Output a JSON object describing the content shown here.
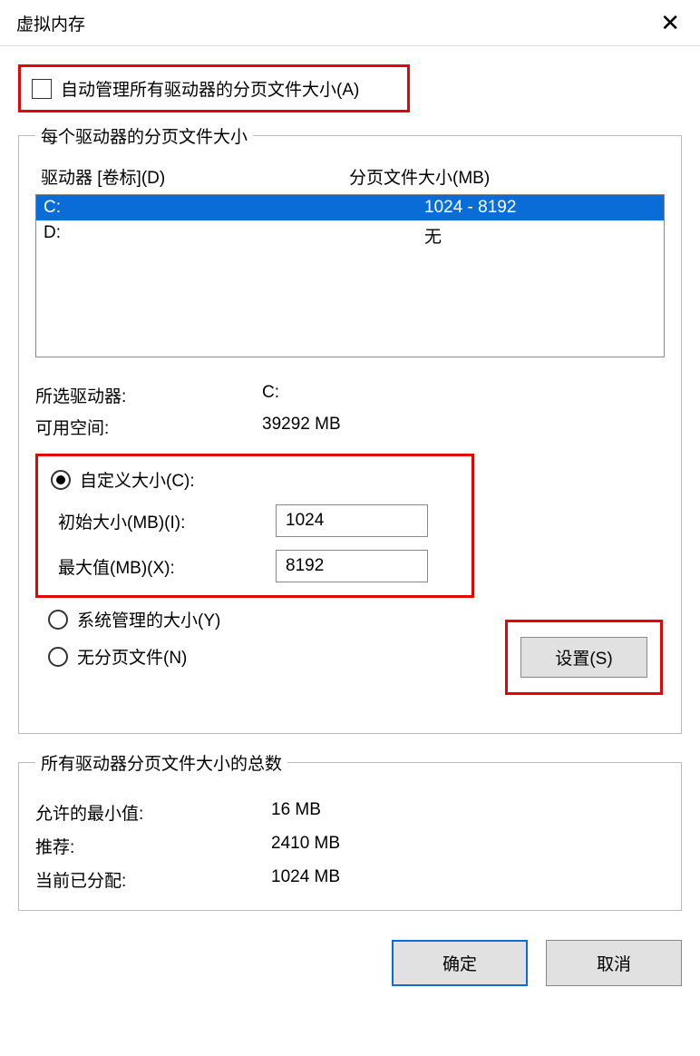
{
  "window": {
    "title": "虚拟内存"
  },
  "autoManage": {
    "label": "自动管理所有驱动器的分页文件大小(A)",
    "checked": false
  },
  "perDrive": {
    "legend": "每个驱动器的分页文件大小",
    "headers": {
      "drive": "驱动器 [卷标](D)",
      "size": "分页文件大小(MB)"
    },
    "drives": [
      {
        "name": "C:",
        "size": "1024 - 8192",
        "selected": true
      },
      {
        "name": "D:",
        "size": "无",
        "selected": false
      }
    ],
    "selectedDrive": {
      "label": "所选驱动器:",
      "value": "C:"
    },
    "freeSpace": {
      "label": "可用空间:",
      "value": "39292 MB"
    },
    "customSize": {
      "radioLabel": "自定义大小(C):",
      "initial": {
        "label": "初始大小(MB)(I):",
        "value": "1024"
      },
      "max": {
        "label": "最大值(MB)(X):",
        "value": "8192"
      }
    },
    "systemManaged": {
      "radioLabel": "系统管理的大小(Y)"
    },
    "noPaging": {
      "radioLabel": "无分页文件(N)"
    },
    "setButton": "设置(S)"
  },
  "totals": {
    "legend": "所有驱动器分页文件大小的总数",
    "min": {
      "label": "允许的最小值:",
      "value": "16 MB"
    },
    "recommended": {
      "label": "推荐:",
      "value": "2410 MB"
    },
    "current": {
      "label": "当前已分配:",
      "value": "1024 MB"
    }
  },
  "buttons": {
    "ok": "确定",
    "cancel": "取消"
  }
}
